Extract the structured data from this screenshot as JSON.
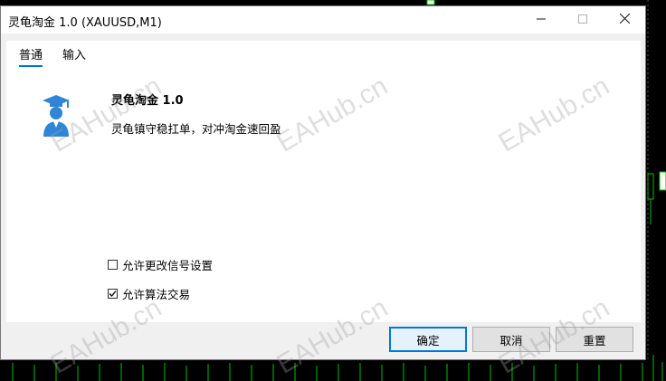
{
  "window": {
    "title": "灵龟淘金 1.0 (XAUUSD,M1)",
    "minimize_icon": "minimize-icon",
    "maximize_icon": "maximize-icon",
    "close_icon": "close-icon"
  },
  "tabs": [
    {
      "label": "普通",
      "active": true
    },
    {
      "label": "输入",
      "active": false
    }
  ],
  "ea": {
    "icon": "expert-advisor-icon",
    "title": "灵龟淘金 1.0",
    "description": "灵龟镇守稳扛单，对冲淘金速回盈"
  },
  "options": [
    {
      "label": "允许更改信号设置",
      "checked": false
    },
    {
      "label": "允许算法交易",
      "checked": true
    }
  ],
  "buttons": {
    "ok": "确定",
    "cancel": "取消",
    "reset": "重置"
  },
  "watermark": "EAHub.cn",
  "colors": {
    "accent": "#0078d7",
    "chart_green": "#00c000"
  }
}
